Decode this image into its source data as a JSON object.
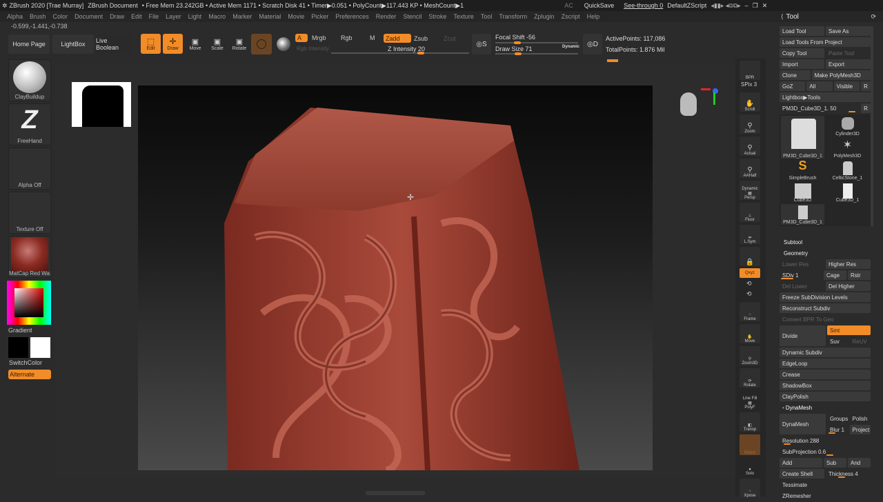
{
  "titlebar": {
    "app": "ZBrush 2020 [Trae Murray]",
    "doc": "ZBrush Document",
    "stats": "• Free Mem 23.242GB • Active Mem 1171 • Scratch Disk 41 • Timer▶0.051 • PolyCount▶117.443 KP • MeshCount▶1",
    "ac": "AC",
    "quicksave": "QuickSave",
    "seethrough": "See-through 0",
    "seethrough_value": 0,
    "script": "DefaultZScript"
  },
  "menu": [
    "Alpha",
    "Brush",
    "Color",
    "Document",
    "Draw",
    "Edit",
    "File",
    "Layer",
    "Light",
    "Macro",
    "Marker",
    "Material",
    "Movie",
    "Picker",
    "Preferences",
    "Render",
    "Stencil",
    "Stroke",
    "Texture",
    "Tool",
    "Transform",
    "Zplugin",
    "Zscript",
    "Help"
  ],
  "coords": "-0.599,-1.441,-0.738",
  "toolbar": {
    "home": "Home Page",
    "lightbox": "LightBox",
    "liveboolean": "Live Boolean",
    "edit": "Edit",
    "draw": "Draw",
    "move": "Move",
    "scale": "Scale",
    "rotate": "Rotate",
    "a": "A",
    "mrgb": "Mrgb",
    "rgb": "Rgb",
    "m": "M",
    "rgb_intensity": "Rgb Intensity",
    "zadd": "Zadd",
    "zsub": "Zsub",
    "zcut": "Zcut",
    "z_intensity": "Z Intensity 20",
    "focal_shift": "Focal Shift -56",
    "draw_size": "Draw Size 71",
    "dynamic": "Dynamic",
    "active_points": "ActivePoints: 117,086",
    "total_points": "TotalPoints: 1.876 Mil",
    "s": "S",
    "d": "D"
  },
  "left": {
    "brush": "ClayBuildup",
    "stroke": "FreeHand",
    "alpha": "Alpha Off",
    "texture": "Texture Off",
    "material": "MatCap Red Wax",
    "gradient": "Gradient",
    "switchcolor": "SwitchColor",
    "alternate": "Alternate"
  },
  "rstrip": {
    "bpr": "BPR",
    "spix": "SPix 3",
    "scroll": "Scroll",
    "zoom": "Zoom",
    "actual": "Actual",
    "aahalf": "AAHalf",
    "dynamic": "Dynamic",
    "persp": "Persp",
    "floor": "Floor",
    "lsym": "L.Sym",
    "xyz": "Qxyz",
    "frame": "Frame",
    "move": "Move",
    "zoom3d": "Zoom3D",
    "rotate": "Rotate",
    "linefill": "Line Fill",
    "polyf": "PolyF",
    "transp": "Transp",
    "ghost": "Ghost",
    "solo": "Solo",
    "xpose": "Xpose"
  },
  "tool": {
    "title": "Tool",
    "load": "Load Tool",
    "saveas": "Save As",
    "loadproj": "Load Tools From Project",
    "copy": "Copy Tool",
    "paste": "Paste Tool",
    "import": "Import",
    "export": "Export",
    "clone": "Clone",
    "makepoly": "Make PolyMesh3D",
    "goz": "GoZ",
    "all": "All",
    "visible": "Visible",
    "r": "R",
    "lightboxtools": "Lightbox▶Tools",
    "current": "PM3D_Cube3D_1. 50",
    "items": [
      "PM3D_Cube3D_1",
      "Cylinder3D",
      "PolyMesh3D",
      "SimpleBrush",
      "CelticStone_1",
      "Cube3D",
      "Cube3D_1",
      "PM3D_Cube3D_1"
    ]
  },
  "subtool": {
    "title": "Subtool",
    "geometry": "Geometry",
    "lowerres": "Lower Res",
    "higherres": "Higher Res",
    "sdiv": "SDiv 1",
    "cage": "Cage",
    "rstr": "Rstr",
    "dellower": "Del Lower",
    "delhigher": "Del Higher",
    "freeze": "Freeze SubDivision Levels",
    "reconstruct": "Reconstruct Subdiv",
    "convert": "Convert BPR To Geo",
    "divide": "Divide",
    "smt": "Smt",
    "suv": "Suv",
    "reuv": "ReUV",
    "dynsub": "Dynamic Subdiv",
    "edgeloop": "EdgeLoop",
    "crease": "Crease",
    "shadowbox": "ShadowBox",
    "claypolish": "ClayPolish",
    "dynamesh_head": "DynaMesh",
    "dynamesh": "DynaMesh",
    "groups": "Groups",
    "polish": "Polish",
    "blur": "Blur 1",
    "project": "Project",
    "resolution": "Resolution 288",
    "subprojection": "SubProjection 0.6",
    "add": "Add",
    "sub": "Sub",
    "and": "And",
    "createshell": "Create Shell",
    "thickness": "Thickness 4",
    "tessimate": "Tessimate",
    "zremesher": "ZRemesher"
  },
  "colors": {
    "accent": "#f28c28",
    "clay": "#9c4436"
  }
}
